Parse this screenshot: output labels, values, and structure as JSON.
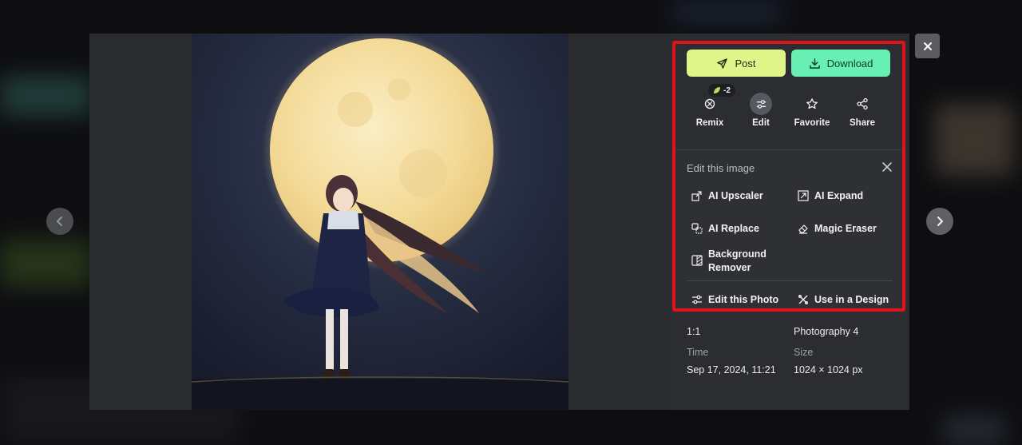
{
  "toolbar": {
    "post_label": "Post",
    "download_label": "Download"
  },
  "actions": {
    "cost_badge": "-2",
    "items": [
      {
        "label": "Remix",
        "icon": "remix-icon"
      },
      {
        "label": "Edit",
        "icon": "sliders-icon"
      },
      {
        "label": "Favorite",
        "icon": "star-icon"
      },
      {
        "label": "Share",
        "icon": "share-icon"
      }
    ]
  },
  "edit_panel": {
    "title": "Edit this image",
    "tools": [
      {
        "label": "AI Upscaler",
        "icon": "upscale-icon"
      },
      {
        "label": "AI Expand",
        "icon": "expand-icon"
      },
      {
        "label": "AI Replace",
        "icon": "replace-icon"
      },
      {
        "label": "Magic Eraser",
        "icon": "eraser-icon"
      },
      {
        "label_line1": "Background",
        "label_line2": "Remover",
        "icon": "background-remover-icon"
      }
    ],
    "footer": [
      {
        "label": "Edit this Photo",
        "icon": "sliders-icon"
      },
      {
        "label": "Use in a Design",
        "icon": "design-icon"
      }
    ]
  },
  "meta": {
    "ratio_value": "1:1",
    "model_value": "Photography 4",
    "time_label": "Time",
    "time_value": "Sep 17, 2024, 11:21",
    "size_label": "Size",
    "size_value": "1024 × 1024 px"
  },
  "colors": {
    "post_bg": "#dff58a",
    "download_bg": "#67efb4",
    "highlight": "#e2121b"
  }
}
